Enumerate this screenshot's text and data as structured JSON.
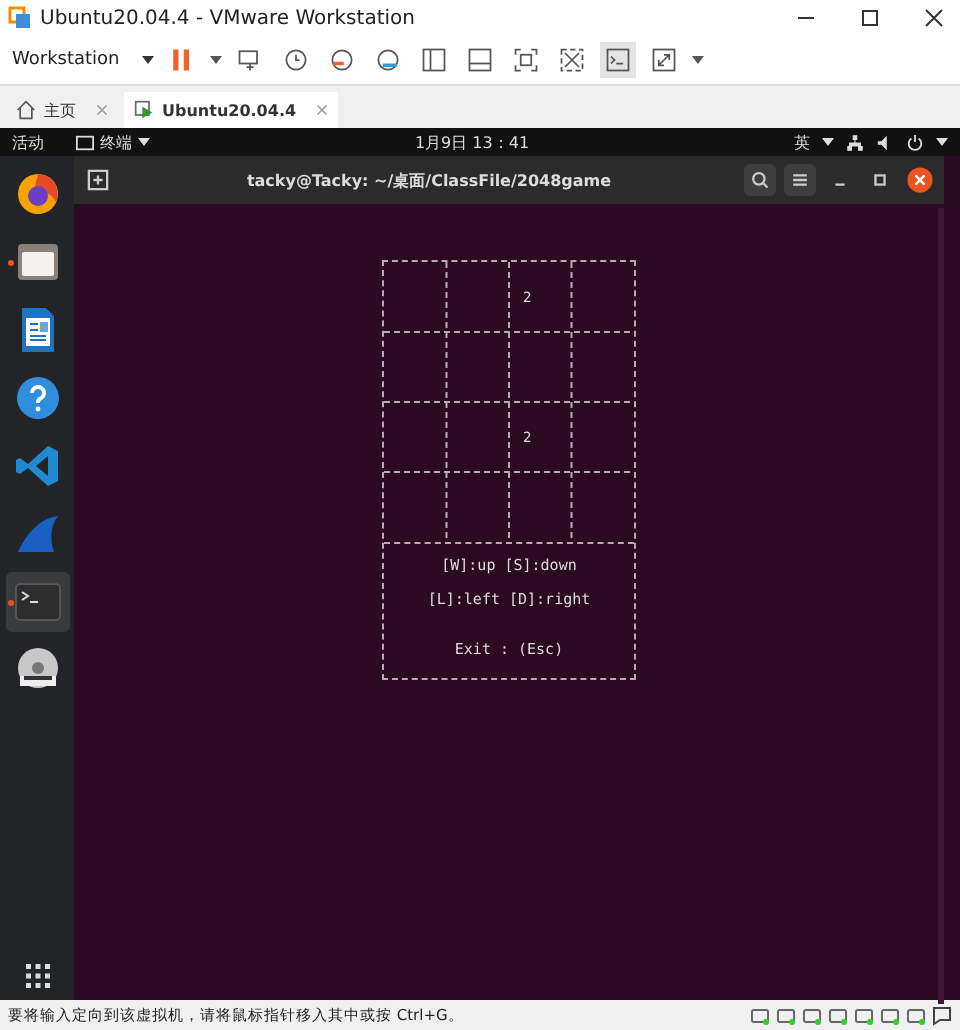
{
  "window": {
    "title": "Ubuntu20.04.4 - VMware Workstation"
  },
  "toolbar": {
    "menu": "Workstation"
  },
  "tabs": [
    {
      "label": "主页",
      "selected": false
    },
    {
      "label": "Ubuntu20.04.4",
      "selected": true
    }
  ],
  "top_bar": {
    "activities": "活动",
    "app_menu": "终端",
    "clock": "1月9日 13：41",
    "input_method": "英"
  },
  "dock": [
    {
      "kind": "firefox",
      "running": false,
      "selected": false
    },
    {
      "kind": "files",
      "running": true,
      "selected": false
    },
    {
      "kind": "writer",
      "running": false,
      "selected": false
    },
    {
      "kind": "help",
      "running": false,
      "selected": false
    },
    {
      "kind": "vscode",
      "running": false,
      "selected": false
    },
    {
      "kind": "wireshark",
      "running": false,
      "selected": false
    },
    {
      "kind": "terminal",
      "running": true,
      "selected": true
    },
    {
      "kind": "dvd",
      "running": false,
      "selected": false
    }
  ],
  "terminal": {
    "title": "tacky@Tacky: ~/桌面/ClassFile/2048game",
    "board": {
      "row_1": {
        "column_3": "2"
      },
      "row_3": {
        "column_3": "2"
      }
    },
    "help": [
      "[W]:up [S]:down",
      "[L]:left [D]:right",
      "Exit : (Esc)"
    ]
  },
  "status_bar": {
    "text": "要将输入定向到该虚拟机，请将鼠标指针移入其中或按 Ctrl+G。"
  }
}
